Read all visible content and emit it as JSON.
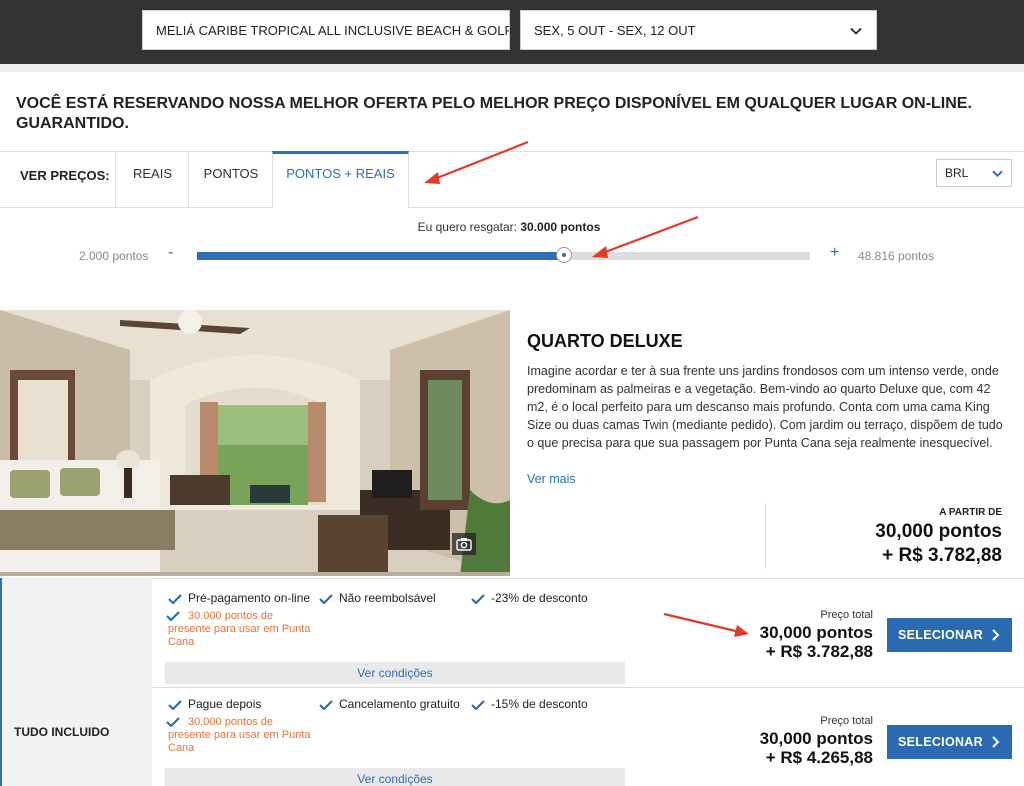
{
  "search": {
    "hotel": "MELIÁ CARIBE TROPICAL ALL INCLUSIVE BEACH & GOLF R",
    "dates": "SEX, 5 OUT - SEX, 12 OUT"
  },
  "guarantee_text": "VOCÊ ESTÁ RESERVANDO NOSSA MELHOR OFERTA PELO MELHOR PREÇO DISPONÍVEL EM QUALQUER LUGAR ON-LINE. GUARANTIDO.",
  "price_view": {
    "label": "VER PREÇOS:",
    "tabs": [
      {
        "label": "REAIS",
        "active": false
      },
      {
        "label": "PONTOS",
        "active": false
      },
      {
        "label": "PONTOS + REAIS",
        "active": true
      }
    ],
    "currency": "BRL"
  },
  "slider": {
    "prefix": "Eu quero resgatar: ",
    "value_text": "30.000 pontos",
    "min_label": "2.000 pontos",
    "max_label": "48.816 pontos",
    "minus": "-",
    "plus": "+",
    "min": 2000,
    "max": 48816,
    "value": 30000
  },
  "room": {
    "title": "QUARTO DELUXE",
    "description": "Imagine acordar e ter à sua frente uns jardins frondosos com um intenso verde, onde predominam as palmeiras e a vegetação. Bem-vindo ao quarto Deluxe que, com 42 m2, é o local perfeito para um descanso mais profundo. Conta com uma cama King Size ou duas camas Twin (mediante pedido). Com jardim ou terraço, dispõem de tudo o que precisa para que sua passagem por Punta Cana seja realmente inesquecível.",
    "more_link": "Ver mais",
    "from_label": "A PARTIR DE",
    "from_points": "30,000 pontos",
    "from_money": "+ R$ 3.782,88",
    "camera_icon": "camera-icon"
  },
  "board": "TUDO INCLUIDO",
  "rates": [
    {
      "features": [
        "Pré-pagamento on-line",
        "Não reembolsável",
        "-23% de desconto"
      ],
      "gift_lines": [
        "30.000 pontos de",
        "presente para usar em Punta",
        "Cana"
      ],
      "conditions": "Ver condições",
      "total_label": "Preço total",
      "total_points": "30,000 pontos",
      "total_money": "+ R$ 3.782,88",
      "button": "SELECIONAR"
    },
    {
      "features": [
        "Pague depois",
        "Cancelamento gratuito",
        "-15% de desconto"
      ],
      "gift_lines": [
        "30.000 pontos de",
        "presente para usar em Punta",
        "Cana"
      ],
      "conditions": "Ver condições",
      "total_label": "Preço total",
      "total_points": "30,000 pontos",
      "total_money": "+ R$ 4.265,88",
      "button": "SELECIONAR"
    }
  ],
  "colors": {
    "brand_blue": "#2c6fb3",
    "gift_orange": "#e8703a",
    "top_bar": "#333333",
    "annotation_red": "#e03a2a"
  }
}
